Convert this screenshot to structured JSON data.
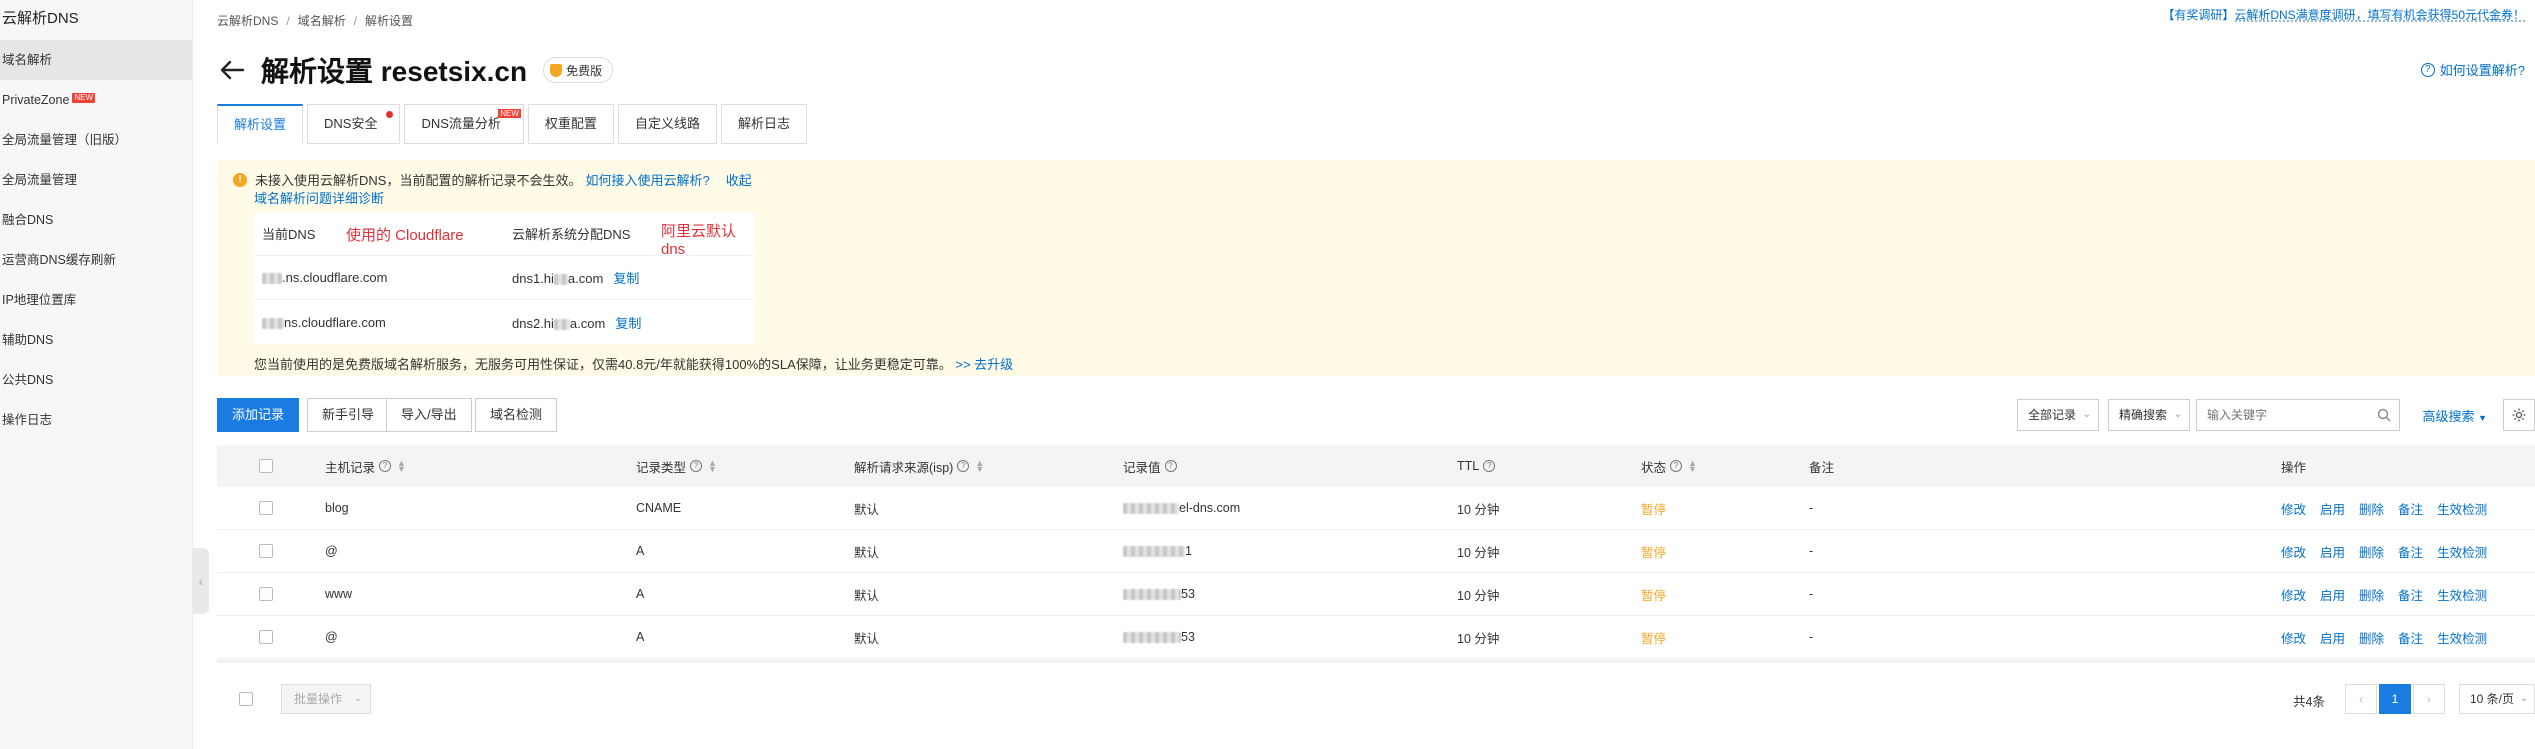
{
  "sidebar": {
    "title": "云解析DNS",
    "items": [
      {
        "label": "域名解析",
        "active": true,
        "badge": ""
      },
      {
        "label": "PrivateZone",
        "badge": "NEW"
      },
      {
        "label": "全局流量管理（旧版）",
        "badge": ""
      },
      {
        "label": "全局流量管理",
        "badge": ""
      },
      {
        "label": "融合DNS",
        "badge": ""
      },
      {
        "label": "运营商DNS缓存刷新",
        "badge": ""
      },
      {
        "label": "IP地理位置库",
        "badge": ""
      },
      {
        "label": "辅助DNS",
        "badge": ""
      },
      {
        "label": "公共DNS",
        "badge": ""
      },
      {
        "label": "操作日志",
        "badge": ""
      }
    ]
  },
  "breadcrumb": [
    "云解析DNS",
    "域名解析",
    "解析设置"
  ],
  "promo": "【有奖调研】云解析DNS满意度调研，填写有机会获得50元代金券！",
  "header": {
    "title": "解析设置 resetsix.cn",
    "edition_badge": "免费版",
    "help_link": "如何设置解析?"
  },
  "tabs": [
    {
      "label": "解析设置",
      "active": true
    },
    {
      "label": "DNS安全",
      "dot": true
    },
    {
      "label": "DNS流量分析",
      "new": "NEW"
    },
    {
      "label": "权重配置"
    },
    {
      "label": "自定义线路"
    },
    {
      "label": "解析日志"
    }
  ],
  "notice": {
    "text": "未接入使用云解析DNS，当前配置的解析记录不会生效。",
    "link_howto": "如何接入使用云解析?",
    "link_collapse": "收起",
    "link_diagnose": "域名解析问题详细诊断",
    "table_headers": [
      "当前DNS",
      "云解析系统分配DNS"
    ],
    "annotation_current": "使用的 Cloudflare",
    "annotation_aliyun": "阿里云默认 dns",
    "copy_label": "复制",
    "rows": [
      {
        "current_suffix": ".ns.cloudflare.com",
        "assigned_prefix": "dns1.hi",
        "assigned_suffix": "a.com"
      },
      {
        "current_suffix": "ns.cloudflare.com",
        "assigned_prefix": "dns2.hi",
        "assigned_suffix": "a.com"
      }
    ],
    "bottom_text": "您当前使用的是免费版域名解析服务，无服务可用性保证，仅需40.8元/年就能获得100%的SLA保障，让业务更稳定可靠。",
    "upgrade_link": ">> 去升级"
  },
  "toolbar": {
    "add_record": "添加记录",
    "guide": "新手引导",
    "import_export": "导入/导出",
    "domain_check": "域名检测",
    "filter_all": "全部记录",
    "search_mode": "精确搜索",
    "search_placeholder": "输入关键字",
    "advanced_search": "高级搜索"
  },
  "table": {
    "headers": {
      "host": "主机记录",
      "type": "记录类型",
      "isp": "解析请求来源(isp)",
      "value": "记录值",
      "ttl": "TTL",
      "status": "状态",
      "remark": "备注",
      "actions": "操作"
    },
    "action_labels": [
      "修改",
      "启用",
      "删除",
      "备注",
      "生效检测"
    ],
    "rows": [
      {
        "host": "blog",
        "type": "CNAME",
        "isp": "默认",
        "value_visible": "el-dns.com",
        "ttl": "10 分钟",
        "status": "暂停",
        "remark": "-"
      },
      {
        "host": "@",
        "type": "A",
        "isp": "默认",
        "value_visible": "1",
        "ttl": "10 分钟",
        "status": "暂停",
        "remark": "-"
      },
      {
        "host": "www",
        "type": "A",
        "isp": "默认",
        "value_visible": "53",
        "ttl": "10 分钟",
        "status": "暂停",
        "remark": "-"
      },
      {
        "host": "@",
        "type": "A",
        "isp": "默认",
        "value_visible": "53",
        "ttl": "10 分钟",
        "status": "暂停",
        "remark": "-"
      }
    ]
  },
  "footer": {
    "batch": "批量操作",
    "total": "共4条",
    "page": "1",
    "page_size": "10 条/页"
  },
  "colors": {
    "primary": "#1a7ce3",
    "link": "#0070cc",
    "paused": "#f5a623",
    "annotation": "#e0323a",
    "notice_bg": "#fffbe6"
  }
}
